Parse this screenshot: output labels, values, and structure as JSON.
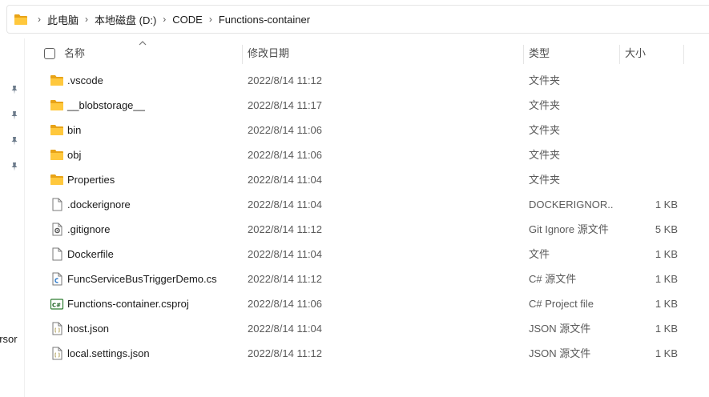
{
  "breadcrumb": {
    "items": [
      "此电脑",
      "本地磁盘 (D:)",
      "CODE",
      "Functions-container"
    ]
  },
  "navigation": {
    "pinned_count": 4,
    "cut_label": "ersor"
  },
  "columns": {
    "name": "名称",
    "date": "修改日期",
    "type": "类型",
    "size": "大小"
  },
  "files": [
    {
      "name": ".vscode",
      "date": "2022/8/14 11:12",
      "type": "文件夹",
      "size": "",
      "icon": "folder-icon"
    },
    {
      "name": "__blobstorage__",
      "date": "2022/8/14 11:17",
      "type": "文件夹",
      "size": "",
      "icon": "folder-icon"
    },
    {
      "name": "bin",
      "date": "2022/8/14 11:06",
      "type": "文件夹",
      "size": "",
      "icon": "folder-icon"
    },
    {
      "name": "obj",
      "date": "2022/8/14 11:06",
      "type": "文件夹",
      "size": "",
      "icon": "folder-icon"
    },
    {
      "name": "Properties",
      "date": "2022/8/14 11:04",
      "type": "文件夹",
      "size": "",
      "icon": "folder-icon"
    },
    {
      "name": ".dockerignore",
      "date": "2022/8/14 11:04",
      "type": "DOCKERIGNOR...",
      "size": "1 KB",
      "icon": "file-icon"
    },
    {
      "name": ".gitignore",
      "date": "2022/8/14 11:12",
      "type": "Git Ignore 源文件",
      "size": "5 KB",
      "icon": "settings-file-icon"
    },
    {
      "name": "Dockerfile",
      "date": "2022/8/14 11:04",
      "type": "文件",
      "size": "1 KB",
      "icon": "file-icon"
    },
    {
      "name": "FuncServiceBusTriggerDemo.cs",
      "date": "2022/8/14 11:12",
      "type": "C# 源文件",
      "size": "1 KB",
      "icon": "csharp-file-icon"
    },
    {
      "name": "Functions-container.csproj",
      "date": "2022/8/14 11:06",
      "type": "C# Project file",
      "size": "1 KB",
      "icon": "csproj-file-icon"
    },
    {
      "name": "host.json",
      "date": "2022/8/14 11:04",
      "type": "JSON 源文件",
      "size": "1 KB",
      "icon": "json-file-icon"
    },
    {
      "name": "local.settings.json",
      "date": "2022/8/14 11:12",
      "type": "JSON 源文件",
      "size": "1 KB",
      "icon": "json-file-icon"
    }
  ],
  "colors": {
    "folder": "#ffc83d",
    "folder_dark": "#e8a317",
    "border": "#e5e5e5"
  }
}
